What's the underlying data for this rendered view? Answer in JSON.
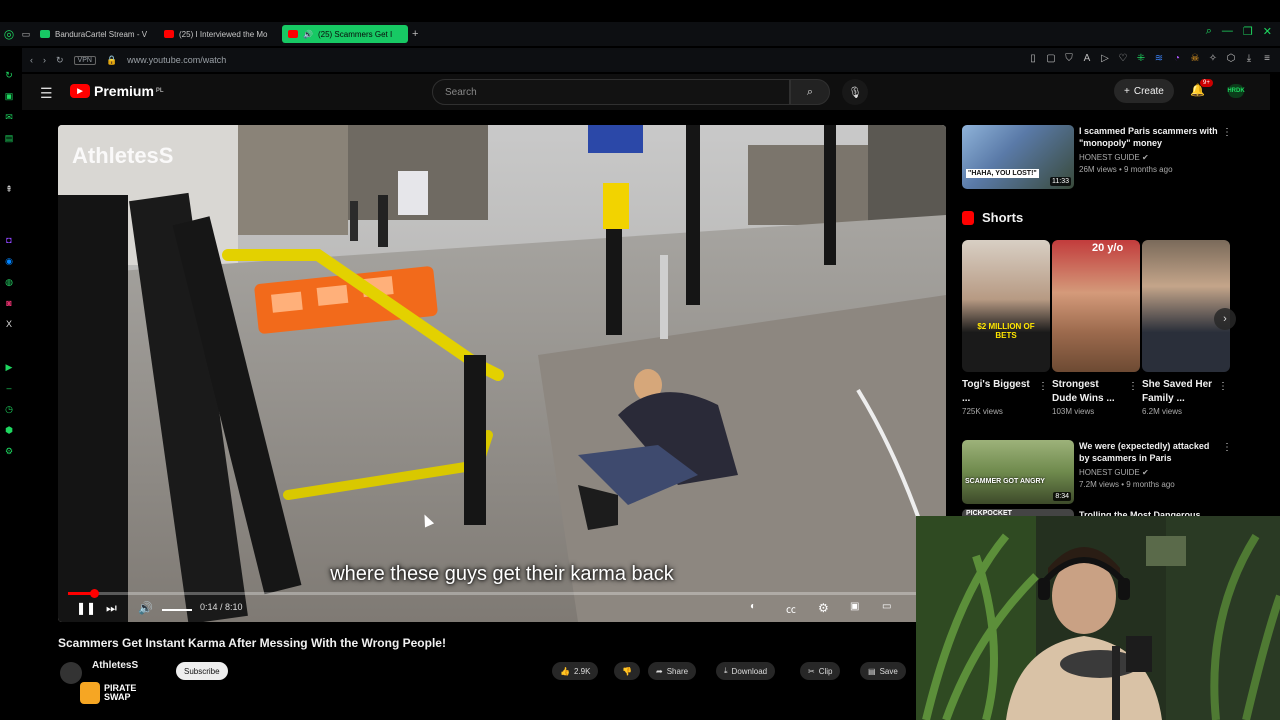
{
  "browser": {
    "tabs": [
      {
        "label": "BanduraCartel Stream - V",
        "color": "#17c964"
      },
      {
        "label": "(25) I Interviewed the Mo",
        "color": "#ff0000"
      },
      {
        "label": "(25) Scammers Get I",
        "color": "#ff0000"
      }
    ],
    "new_tab": "+",
    "vpn": "VPN",
    "url": "www.youtube.com/watch",
    "accent": "#1ed760"
  },
  "youtube": {
    "logo": "Premium",
    "logo_sup": "PL",
    "search_placeholder": "Search",
    "create_label": "Create",
    "notif_badge": "9+",
    "avatar_text": "HRDK"
  },
  "player": {
    "overlay_title": "AthletesS",
    "caption": "where these guys get their karma back",
    "time": "0:14 / 8:10",
    "progress": 0.03
  },
  "video": {
    "title": "Scammers Get Instant Karma After Messing With the Wrong People!",
    "channel": "AthletesS",
    "subscribe": "Subscribe",
    "likes": "2.9K",
    "share": "Share",
    "download": "Download",
    "clip": "Clip",
    "save": "Save"
  },
  "recommendations": [
    {
      "title": "I scammed Paris scammers with \"monopoly\" money",
      "channel": "HONEST GUIDE ✔",
      "meta": "26M views • 9 months ago",
      "duration": "11:33",
      "thumb_text": "\"HAHA, YOU LOST!\""
    },
    {
      "title": "We were (expectedly) attacked by scammers in Paris",
      "channel": "HONEST GUIDE ✔",
      "meta": "7.2M views • 9 months ago",
      "duration": "8:34",
      "thumb_text": "SCAMMER GOT ANGRY"
    },
    {
      "title": "Trolling the Most Dangerous",
      "channel": "",
      "meta": "",
      "duration": "",
      "thumb_text": "PICKPOCKET"
    }
  ],
  "shorts": {
    "heading": "Shorts",
    "items": [
      {
        "title": "Togi's Biggest ...",
        "views": "725K views",
        "overlay": "$2 MILLION OF BETS"
      },
      {
        "title": "Strongest Dude Wins ...",
        "views": "103M views",
        "overlay": "20 y/o"
      },
      {
        "title": "She Saved Her Family ...",
        "views": "6.2M views",
        "overlay": ""
      }
    ]
  },
  "sponsor": {
    "line1": "PIRATE",
    "line2": "SWAP"
  }
}
